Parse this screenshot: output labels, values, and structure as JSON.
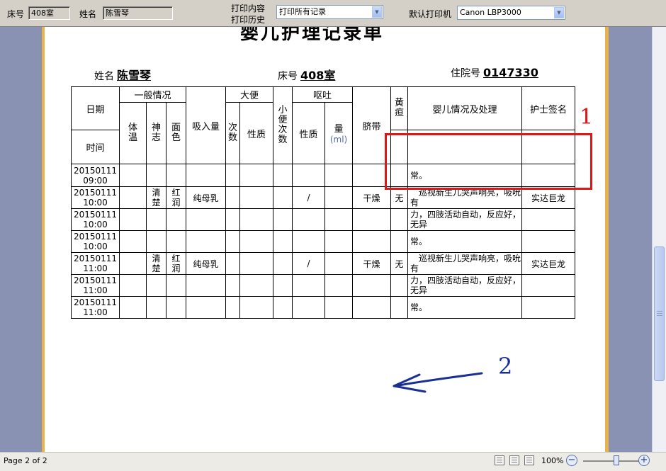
{
  "toolbar": {
    "bed_label": "床号",
    "bed_value": "408室",
    "name_label": "姓名",
    "name_value": "陈雪琴",
    "print_content_label": "打印内容",
    "print_history_label": "打印历史",
    "print_select_value": "打印所有记录",
    "default_printer_label": "默认打印机",
    "printer_select_value": "Canon LBP3000"
  },
  "document": {
    "title": "婴儿护理记录单",
    "name_label": "姓名",
    "name_value": "陈雪琴",
    "bed_label": "床号",
    "bed_value": "408室",
    "admission_label": "住院号",
    "admission_value": "0147330"
  },
  "table": {
    "headers": {
      "date": "日期",
      "time": "时间",
      "general": "一般情况",
      "temperature": "体温",
      "mind": "神志",
      "complexion": "面色",
      "intake": "吸入量",
      "stool": "大便",
      "stool_times": "次数",
      "stool_nature": "性质",
      "urine_times": "小便次数",
      "vomit": "呕吐",
      "vomit_nature": "性质",
      "vomit_amount": "量",
      "vomit_unit": "(ml)",
      "umbilical": "脐带",
      "jaundice": "黄疸",
      "condition": "婴儿情况及处理",
      "nurse": "护士签名"
    },
    "rows": [
      {
        "time": "",
        "mind": "",
        "complexion": "",
        "intake": "",
        "vomit_nature": "",
        "umbilical": "",
        "jaundice": "",
        "desc": "",
        "nurse": ""
      },
      {
        "time": "20150111 09:00",
        "mind": "",
        "complexion": "",
        "intake": "",
        "vomit_nature": "",
        "umbilical": "",
        "jaundice": "",
        "desc": "常。",
        "nurse": ""
      },
      {
        "time": "20150111 10:00",
        "mind": "清楚",
        "complexion": "红润",
        "intake": "纯母乳",
        "vomit_nature": "/",
        "umbilical": "干燥",
        "jaundice": "无",
        "desc": "　巡视新生儿哭声响亮，吸吮有",
        "nurse": "实达巨龙"
      },
      {
        "time": "20150111 10:00",
        "mind": "",
        "complexion": "",
        "intake": "",
        "vomit_nature": "",
        "umbilical": "",
        "jaundice": "",
        "desc": "力，四肢活动自动，反应好，无异",
        "nurse": ""
      },
      {
        "time": "20150111 10:00",
        "mind": "",
        "complexion": "",
        "intake": "",
        "vomit_nature": "",
        "umbilical": "",
        "jaundice": "",
        "desc": "常。",
        "nurse": ""
      },
      {
        "time": "20150111 11:00",
        "mind": "清楚",
        "complexion": "红润",
        "intake": "纯母乳",
        "vomit_nature": "/",
        "umbilical": "干燥",
        "jaundice": "无",
        "desc": "　巡视新生儿哭声响亮，吸吮有",
        "nurse": "实达巨龙"
      },
      {
        "time": "20150111 11:00",
        "mind": "",
        "complexion": "",
        "intake": "",
        "vomit_nature": "",
        "umbilical": "",
        "jaundice": "",
        "desc": "力，四肢活动自动，反应好，无异",
        "nurse": ""
      },
      {
        "time": "20150111 11:00",
        "mind": "",
        "complexion": "",
        "intake": "",
        "vomit_nature": "",
        "umbilical": "",
        "jaundice": "",
        "desc": "常。",
        "nurse": ""
      }
    ]
  },
  "annotations": {
    "label_1": "1",
    "label_2": "2",
    "box_color": "#e01616",
    "arrow_color": "#1a2f93"
  },
  "statusbar": {
    "page_indicator": "Page 2 of 2",
    "zoom_label": "100%",
    "zoom_out": "−",
    "zoom_in": "+",
    "zoom_level": 0.6
  }
}
